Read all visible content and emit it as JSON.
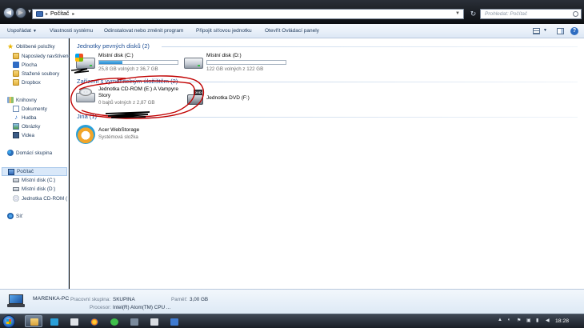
{
  "address": {
    "location": "Počítač",
    "search_placeholder": "Prohledat: Počítač"
  },
  "commands": {
    "organize": "Uspořádat",
    "system_properties": "Vlastnosti systému",
    "uninstall": "Odinstalovat nebo změnit program",
    "map_drive": "Připojit síťovou jednotku",
    "control_panel": "Otevřít Ovládací panely"
  },
  "sidebar": {
    "favorites": "Oblíbené položky",
    "recent": "Naposledy navštívené",
    "desktop": "Plocha",
    "downloads": "Stažené soubory",
    "dropbox": "Dropbox",
    "libraries": "Knihovny",
    "documents": "Dokumenty",
    "music": "Hudba",
    "pictures": "Obrázky",
    "videos": "Videa",
    "homegroup": "Domácí skupina",
    "computer": "Počítač",
    "local_c": "Místní disk (C:)",
    "local_d": "Místní disk (D:)",
    "cdrom": "Jednotka CD-ROM (",
    "network": "Síť"
  },
  "groups": {
    "hdd": "Jednotky pevných disků (2)",
    "removable": "Zařízení s vyměnitelným úložištěm (2)",
    "other": "Jiná (1)"
  },
  "drives": {
    "c_name": "Místní disk (C:)",
    "c_free": "25,8 GB volných z 36,7 GB",
    "c_used_fraction": 0.3,
    "d_name": "Místní disk (D:)",
    "d_free": "122 GB volných z 122 GB",
    "d_used_fraction": 0.0,
    "cdrom_name_1": "Jednotka CD-ROM (E:) A Vampyre",
    "cdrom_name_2": "Story",
    "cdrom_free": "0 bajtů volných z 2,87 GB",
    "dvd_name": "Jednotka DVD (F:)",
    "dvd_tag": "DVD",
    "other_name": "Acer WebStorage",
    "other_type": "Systémová složka"
  },
  "details": {
    "pc_name": "MARENKA-PC",
    "workgroup_label": "Pracovní skupina:",
    "workgroup_value": "SKUPINA",
    "memory_label": "Paměť:",
    "memory_value": "3,00 GB",
    "cpu_label": "Procesor:",
    "cpu_value": "Intel(R) Atom(TM) CPU ..."
  },
  "taskbar": {
    "clock": "18:28"
  },
  "colors": {
    "accent": "#1e4f95",
    "usage_bar": "#2a8ad2",
    "annotation": "#c00000"
  }
}
